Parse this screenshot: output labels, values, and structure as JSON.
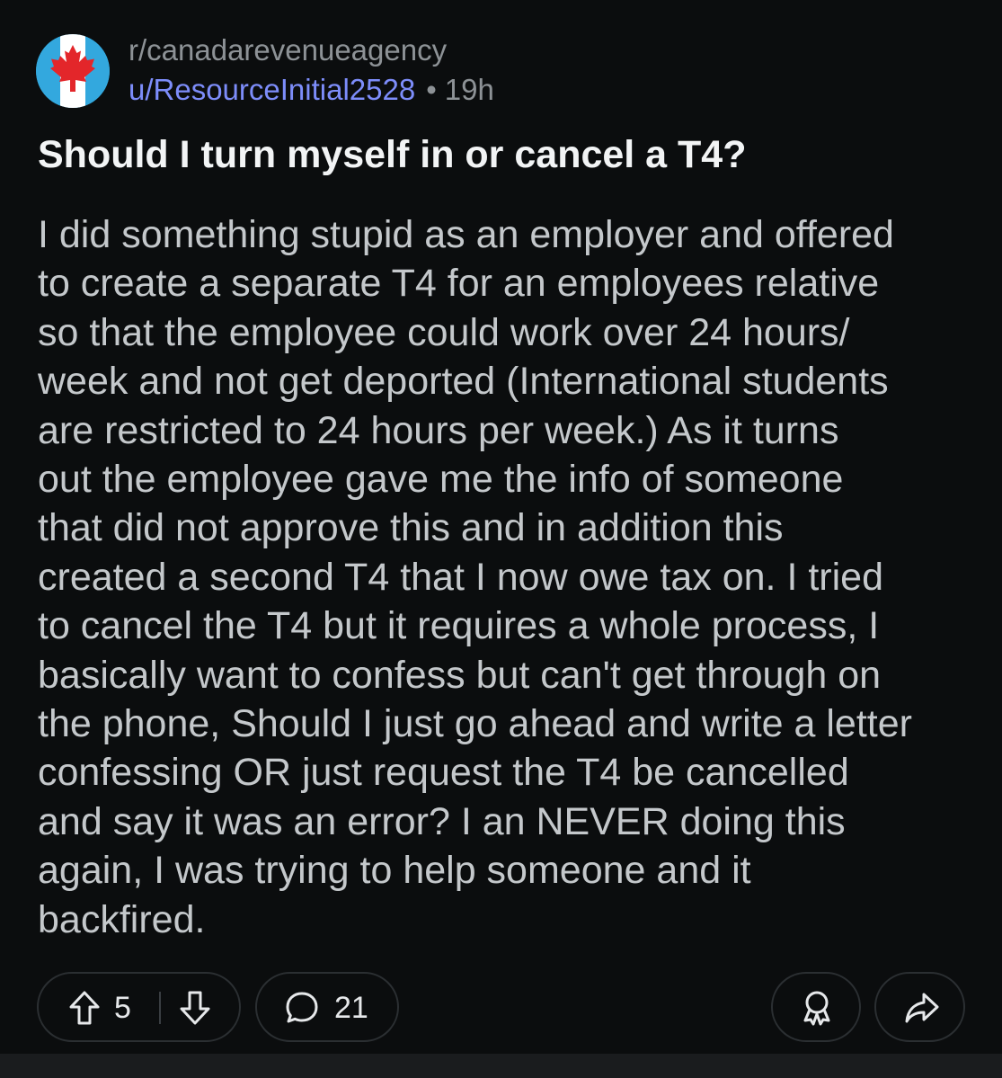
{
  "post": {
    "subreddit": "r/canadarevenueagency",
    "author": "u/ResourceInitial2528",
    "separator": "•",
    "age": "19h",
    "title": "Should I turn myself in or cancel a T4?",
    "body_lines": [
      "I did something stupid as an employer and offered",
      "to create a separate T4 for an employees relative",
      "so that the employee could work over 24 hours/",
      "week and not get deported (International students",
      "are restricted to 24 hours per week.) As it turns",
      "out the employee gave me the info of someone",
      "that did not approve this and in addition this",
      "created a second T4 that I now owe tax on. I tried",
      "to cancel the T4 but it requires a whole process, I",
      "basically want to confess but can't get through on",
      "the phone, Should I just go ahead and write a letter",
      "confessing OR just request the T4 be cancelled",
      "and say it was an error? I an NEVER doing this",
      "again, I was trying to help someone and it",
      "backfired."
    ]
  },
  "actions": {
    "vote_count": "5",
    "comment_count": "21"
  },
  "icons": {
    "avatar": "maple-leaf-icon",
    "upvote": "upvote-arrow-icon",
    "downvote": "downvote-arrow-icon",
    "comments": "comment-bubble-icon",
    "award": "award-icon",
    "share": "share-arrow-icon"
  },
  "colors": {
    "background": "#0b0d0e",
    "username": "#7d8dfa",
    "avatar_bg": "#33a8de",
    "maple_leaf": "#e3262a"
  }
}
